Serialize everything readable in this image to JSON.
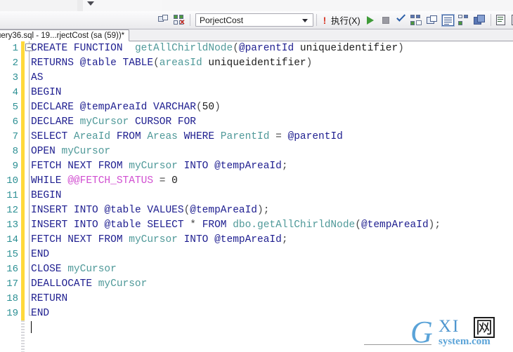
{
  "window": {
    "app": "SQL Server Management Studio",
    "mini_dropdown_icon": "chevron-down-icon"
  },
  "toolbar": {
    "gripper_icon": "drag-gripper-icon",
    "items": [
      {
        "name": "new-query-icon",
        "label": ""
      },
      {
        "name": "disconnect-icon",
        "label": ""
      }
    ],
    "database_combo": {
      "value": "PorjectCost",
      "caret_icon": "chevron-down-icon"
    },
    "execute": {
      "bang_icon": "exclamation-icon",
      "label": "执行(X)"
    },
    "debug_icon": "play-triangle-icon",
    "stop_icon": "stop-square-icon",
    "parse_icon": "checkmark-icon",
    "display_estimated_plan_icon": "estimated-plan-icon",
    "query_options_icon": "query-options-icon",
    "results_to_text_icon": "results-to-text-icon",
    "include_actual_plan_icon": "actual-plan-icon",
    "results_to_grid_icon": "results-to-grid-icon",
    "results_to_file_icon": "results-to-file-icon",
    "comment_icon": "comment-lines-icon"
  },
  "tab": {
    "title": "uery36.sql - 19...rjectCost (sa (59))*",
    "dirty": true
  },
  "editor": {
    "gutter": {
      "change_bar_color": "#ffd93a",
      "line_number_color": "#2b8f93"
    },
    "collapse_icon": "collapse-minus-icon",
    "lines": [
      {
        "n": "1",
        "tokens": [
          {
            "t": "CREATE",
            "c": "kw"
          },
          {
            "t": " ",
            "c": "id"
          },
          {
            "t": "FUNCTION",
            "c": "kw"
          },
          {
            "t": "  ",
            "c": "id"
          },
          {
            "t": "getAllChirldNode",
            "c": "tbl"
          },
          {
            "t": "(",
            "c": "op"
          },
          {
            "t": "@parentId",
            "c": "var"
          },
          {
            "t": " ",
            "c": "id"
          },
          {
            "t": "uniqueidentifier",
            "c": "id"
          },
          {
            "t": ")",
            "c": "op"
          }
        ]
      },
      {
        "n": "2",
        "tokens": [
          {
            "t": "RETURNS",
            "c": "kw"
          },
          {
            "t": " ",
            "c": "id"
          },
          {
            "t": "@table",
            "c": "var"
          },
          {
            "t": " ",
            "c": "id"
          },
          {
            "t": "TABLE",
            "c": "kw"
          },
          {
            "t": "(",
            "c": "op"
          },
          {
            "t": "areasId",
            "c": "tbl"
          },
          {
            "t": " ",
            "c": "id"
          },
          {
            "t": "uniqueidentifier",
            "c": "id"
          },
          {
            "t": ")",
            "c": "op"
          }
        ]
      },
      {
        "n": "3",
        "tokens": [
          {
            "t": "AS",
            "c": "kw"
          }
        ]
      },
      {
        "n": "4",
        "tokens": [
          {
            "t": "BEGIN",
            "c": "kw"
          }
        ]
      },
      {
        "n": "5",
        "tokens": [
          {
            "t": "DECLARE",
            "c": "kw"
          },
          {
            "t": " ",
            "c": "id"
          },
          {
            "t": "@tempAreaId",
            "c": "var"
          },
          {
            "t": " ",
            "c": "id"
          },
          {
            "t": "VARCHAR",
            "c": "kw"
          },
          {
            "t": "(",
            "c": "op"
          },
          {
            "t": "50",
            "c": "id"
          },
          {
            "t": ")",
            "c": "op"
          }
        ]
      },
      {
        "n": "6",
        "tokens": [
          {
            "t": "DECLARE",
            "c": "kw"
          },
          {
            "t": " ",
            "c": "id"
          },
          {
            "t": "myCursor",
            "c": "tbl"
          },
          {
            "t": " ",
            "c": "id"
          },
          {
            "t": "CURSOR",
            "c": "kw"
          },
          {
            "t": " ",
            "c": "id"
          },
          {
            "t": "FOR",
            "c": "kw"
          }
        ]
      },
      {
        "n": "7",
        "tokens": [
          {
            "t": "SELECT",
            "c": "kw"
          },
          {
            "t": " ",
            "c": "id"
          },
          {
            "t": "AreaId",
            "c": "tbl"
          },
          {
            "t": " ",
            "c": "id"
          },
          {
            "t": "FROM",
            "c": "kw"
          },
          {
            "t": " ",
            "c": "id"
          },
          {
            "t": "Areas",
            "c": "tbl"
          },
          {
            "t": " ",
            "c": "id"
          },
          {
            "t": "WHERE",
            "c": "kw"
          },
          {
            "t": " ",
            "c": "id"
          },
          {
            "t": "ParentId",
            "c": "tbl"
          },
          {
            "t": " ",
            "c": "id"
          },
          {
            "t": "=",
            "c": "op"
          },
          {
            "t": " ",
            "c": "id"
          },
          {
            "t": "@parentId",
            "c": "var"
          }
        ]
      },
      {
        "n": "8",
        "tokens": [
          {
            "t": "OPEN",
            "c": "kw"
          },
          {
            "t": " ",
            "c": "id"
          },
          {
            "t": "myCursor",
            "c": "tbl"
          }
        ]
      },
      {
        "n": "9",
        "tokens": [
          {
            "t": "FETCH",
            "c": "kw"
          },
          {
            "t": " ",
            "c": "id"
          },
          {
            "t": "NEXT",
            "c": "kw"
          },
          {
            "t": " ",
            "c": "id"
          },
          {
            "t": "FROM",
            "c": "kw"
          },
          {
            "t": " ",
            "c": "id"
          },
          {
            "t": "myCursor",
            "c": "tbl"
          },
          {
            "t": " ",
            "c": "id"
          },
          {
            "t": "INTO",
            "c": "kw"
          },
          {
            "t": " ",
            "c": "id"
          },
          {
            "t": "@tempAreaId",
            "c": "var"
          },
          {
            "t": ";",
            "c": "op"
          }
        ]
      },
      {
        "n": "10",
        "tokens": [
          {
            "t": "WHILE",
            "c": "kw"
          },
          {
            "t": " ",
            "c": "id"
          },
          {
            "t": "@@FETCH_STATUS",
            "c": "sysf"
          },
          {
            "t": " ",
            "c": "id"
          },
          {
            "t": "=",
            "c": "op"
          },
          {
            "t": " ",
            "c": "id"
          },
          {
            "t": "0",
            "c": "id"
          }
        ]
      },
      {
        "n": "11",
        "tokens": [
          {
            "t": "BEGIN",
            "c": "kw"
          }
        ]
      },
      {
        "n": "12",
        "tokens": [
          {
            "t": "INSERT",
            "c": "kw"
          },
          {
            "t": " ",
            "c": "id"
          },
          {
            "t": "INTO",
            "c": "kw"
          },
          {
            "t": " ",
            "c": "id"
          },
          {
            "t": "@table",
            "c": "var"
          },
          {
            "t": " ",
            "c": "id"
          },
          {
            "t": "VALUES",
            "c": "kw"
          },
          {
            "t": "(",
            "c": "op"
          },
          {
            "t": "@tempAreaId",
            "c": "var"
          },
          {
            "t": ");",
            "c": "op"
          }
        ]
      },
      {
        "n": "13",
        "tokens": [
          {
            "t": "INSERT",
            "c": "kw"
          },
          {
            "t": " ",
            "c": "id"
          },
          {
            "t": "INTO",
            "c": "kw"
          },
          {
            "t": " ",
            "c": "id"
          },
          {
            "t": "@table",
            "c": "var"
          },
          {
            "t": " ",
            "c": "id"
          },
          {
            "t": "SELECT",
            "c": "kw"
          },
          {
            "t": " ",
            "c": "id"
          },
          {
            "t": "*",
            "c": "op"
          },
          {
            "t": " ",
            "c": "id"
          },
          {
            "t": "FROM",
            "c": "kw"
          },
          {
            "t": " ",
            "c": "id"
          },
          {
            "t": "dbo.getAllChirldNode",
            "c": "tbl"
          },
          {
            "t": "(",
            "c": "op"
          },
          {
            "t": "@tempAreaId",
            "c": "var"
          },
          {
            "t": ");",
            "c": "op"
          }
        ]
      },
      {
        "n": "14",
        "tokens": [
          {
            "t": "FETCH",
            "c": "kw"
          },
          {
            "t": " ",
            "c": "id"
          },
          {
            "t": "NEXT",
            "c": "kw"
          },
          {
            "t": " ",
            "c": "id"
          },
          {
            "t": "FROM",
            "c": "kw"
          },
          {
            "t": " ",
            "c": "id"
          },
          {
            "t": "myCursor",
            "c": "tbl"
          },
          {
            "t": " ",
            "c": "id"
          },
          {
            "t": "INTO",
            "c": "kw"
          },
          {
            "t": " ",
            "c": "id"
          },
          {
            "t": "@tempAreaId",
            "c": "var"
          },
          {
            "t": ";",
            "c": "op"
          }
        ]
      },
      {
        "n": "15",
        "tokens": [
          {
            "t": "END",
            "c": "kw"
          }
        ]
      },
      {
        "n": "16",
        "tokens": [
          {
            "t": "CLOSE",
            "c": "kw"
          },
          {
            "t": " ",
            "c": "id"
          },
          {
            "t": "myCursor",
            "c": "tbl"
          }
        ]
      },
      {
        "n": "17",
        "tokens": [
          {
            "t": "DEALLOCATE",
            "c": "kw"
          },
          {
            "t": " ",
            "c": "id"
          },
          {
            "t": "myCursor",
            "c": "tbl"
          }
        ]
      },
      {
        "n": "18",
        "tokens": [
          {
            "t": "RETURN",
            "c": "kw"
          }
        ]
      },
      {
        "n": "19",
        "tokens": [
          {
            "t": "END",
            "c": "kw"
          }
        ]
      }
    ]
  },
  "watermark": {
    "g": "G",
    "xi": "XI",
    "net": "网",
    "system": "system.com"
  }
}
